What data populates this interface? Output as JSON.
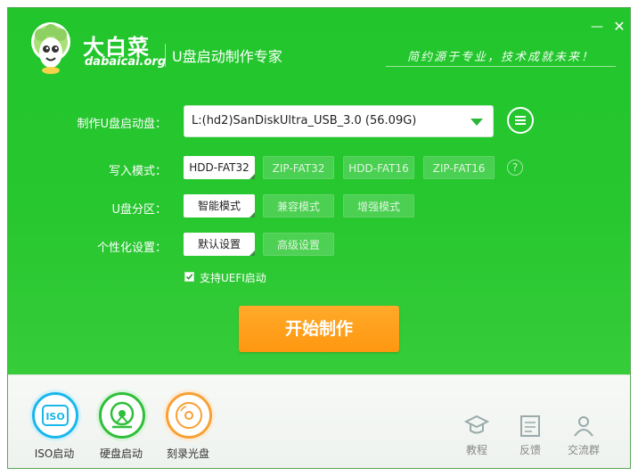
{
  "header": {
    "brand_cn": "大白菜",
    "brand_en": "dabaicai.org",
    "app_title": "U盘启动制作专家",
    "slogan": "简约源于专业，技术成就未来！",
    "minimize_glyph": "—",
    "close_glyph": "✕"
  },
  "form": {
    "drive_label": "制作U盘启动盘：",
    "drive_value": "L:(hd2)SanDiskUltra_USB_3.0 (56.09G)",
    "write_mode_label": "写入模式：",
    "write_modes": [
      "HDD-FAT32",
      "ZIP-FAT32",
      "HDD-FAT16",
      "ZIP-FAT16"
    ],
    "partition_label": "U盘分区：",
    "partition_modes": [
      "智能模式",
      "兼容模式",
      "增强模式"
    ],
    "personalize_label": "个性化设置：",
    "personalize_modes": [
      "默认设置",
      "高级设置"
    ],
    "help_glyph": "?",
    "uefi_label": "支持UEFI启动",
    "uefi_checked": true
  },
  "start_button": "开始制作",
  "footer": {
    "tools": [
      {
        "label": "ISO启动",
        "icon": "iso-icon",
        "color": "#1ab7ea"
      },
      {
        "label": "硬盘启动",
        "icon": "hard-disk-icon",
        "color": "#2fbf3a"
      },
      {
        "label": "刻录光盘",
        "icon": "disc-icon",
        "color": "#f7a035"
      }
    ],
    "links": [
      {
        "label": "教程",
        "icon": "tutorial-icon"
      },
      {
        "label": "反馈",
        "icon": "feedback-icon"
      },
      {
        "label": "交流群",
        "icon": "group-icon"
      }
    ]
  },
  "colors": {
    "main_green": "#27c72f",
    "start_orange": "#ff9f1a",
    "accent_green": "#2bb638"
  }
}
